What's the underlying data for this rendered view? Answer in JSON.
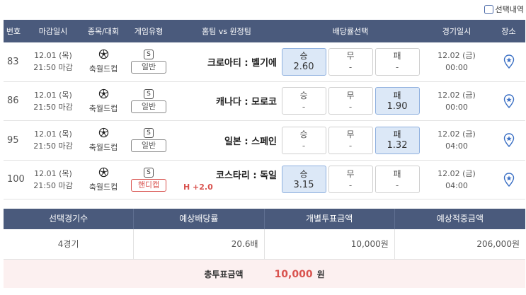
{
  "top": {
    "checkbox_label": "선택내역"
  },
  "headers": [
    "번호",
    "마감일시",
    "종목/대회",
    "게임유형",
    "홈팀 vs 원정팀",
    "배당률선택",
    "경기일시",
    "장소"
  ],
  "rows": [
    {
      "no": "83",
      "date": "12.01 (목)",
      "time": "21:50 마감",
      "league": "축월드컵",
      "badge": "S",
      "type": "일반",
      "teams": "크로아티 : 벨기에",
      "sub": "",
      "odds": [
        {
          "label": "승",
          "value": "2.60",
          "sel": true
        },
        {
          "label": "무",
          "value": "-",
          "sel": false
        },
        {
          "label": "패",
          "value": "-",
          "sel": false
        }
      ],
      "game_date": "12.02 (금)",
      "game_time": "00:00"
    },
    {
      "no": "86",
      "date": "12.01 (목)",
      "time": "21:50 마감",
      "league": "축월드컵",
      "badge": "S",
      "type": "일반",
      "teams": "캐나다 : 모로코",
      "sub": "",
      "odds": [
        {
          "label": "승",
          "value": "-",
          "sel": false
        },
        {
          "label": "무",
          "value": "-",
          "sel": false
        },
        {
          "label": "패",
          "value": "1.90",
          "sel": true
        }
      ],
      "game_date": "12.02 (금)",
      "game_time": "00:00"
    },
    {
      "no": "95",
      "date": "12.01 (목)",
      "time": "21:50 마감",
      "league": "축월드컵",
      "badge": "S",
      "type": "일반",
      "teams": "일본 : 스페인",
      "sub": "",
      "odds": [
        {
          "label": "승",
          "value": "-",
          "sel": false
        },
        {
          "label": "무",
          "value": "-",
          "sel": false
        },
        {
          "label": "패",
          "value": "1.32",
          "sel": true
        }
      ],
      "game_date": "12.02 (금)",
      "game_time": "04:00"
    },
    {
      "no": "100",
      "date": "12.01 (목)",
      "time": "21:50 마감",
      "league": "축월드컵",
      "badge": "S",
      "type": "핸디캡",
      "teams": "코스타리 : 독일",
      "sub": "H +2.0",
      "odds": [
        {
          "label": "승",
          "value": "3.15",
          "sel": true
        },
        {
          "label": "무",
          "value": "-",
          "sel": false
        },
        {
          "label": "패",
          "value": "-",
          "sel": false
        }
      ],
      "game_date": "12.02 (금)",
      "game_time": "04:00"
    }
  ],
  "summary": {
    "headers": [
      "선택경기수",
      "예상배당률",
      "개별투표금액",
      "예상적중금액"
    ],
    "values": [
      "4경기",
      "20.6배",
      "10,000원",
      "206,000원"
    ]
  },
  "total": {
    "label": "총투표금액",
    "amount": "10,000",
    "unit": "원"
  },
  "colors": {
    "header_bg": "#4a5a7c",
    "selected_odd": "#dce8f7",
    "handicap": "#d9534f",
    "total_bg": "#fcf0f0"
  }
}
